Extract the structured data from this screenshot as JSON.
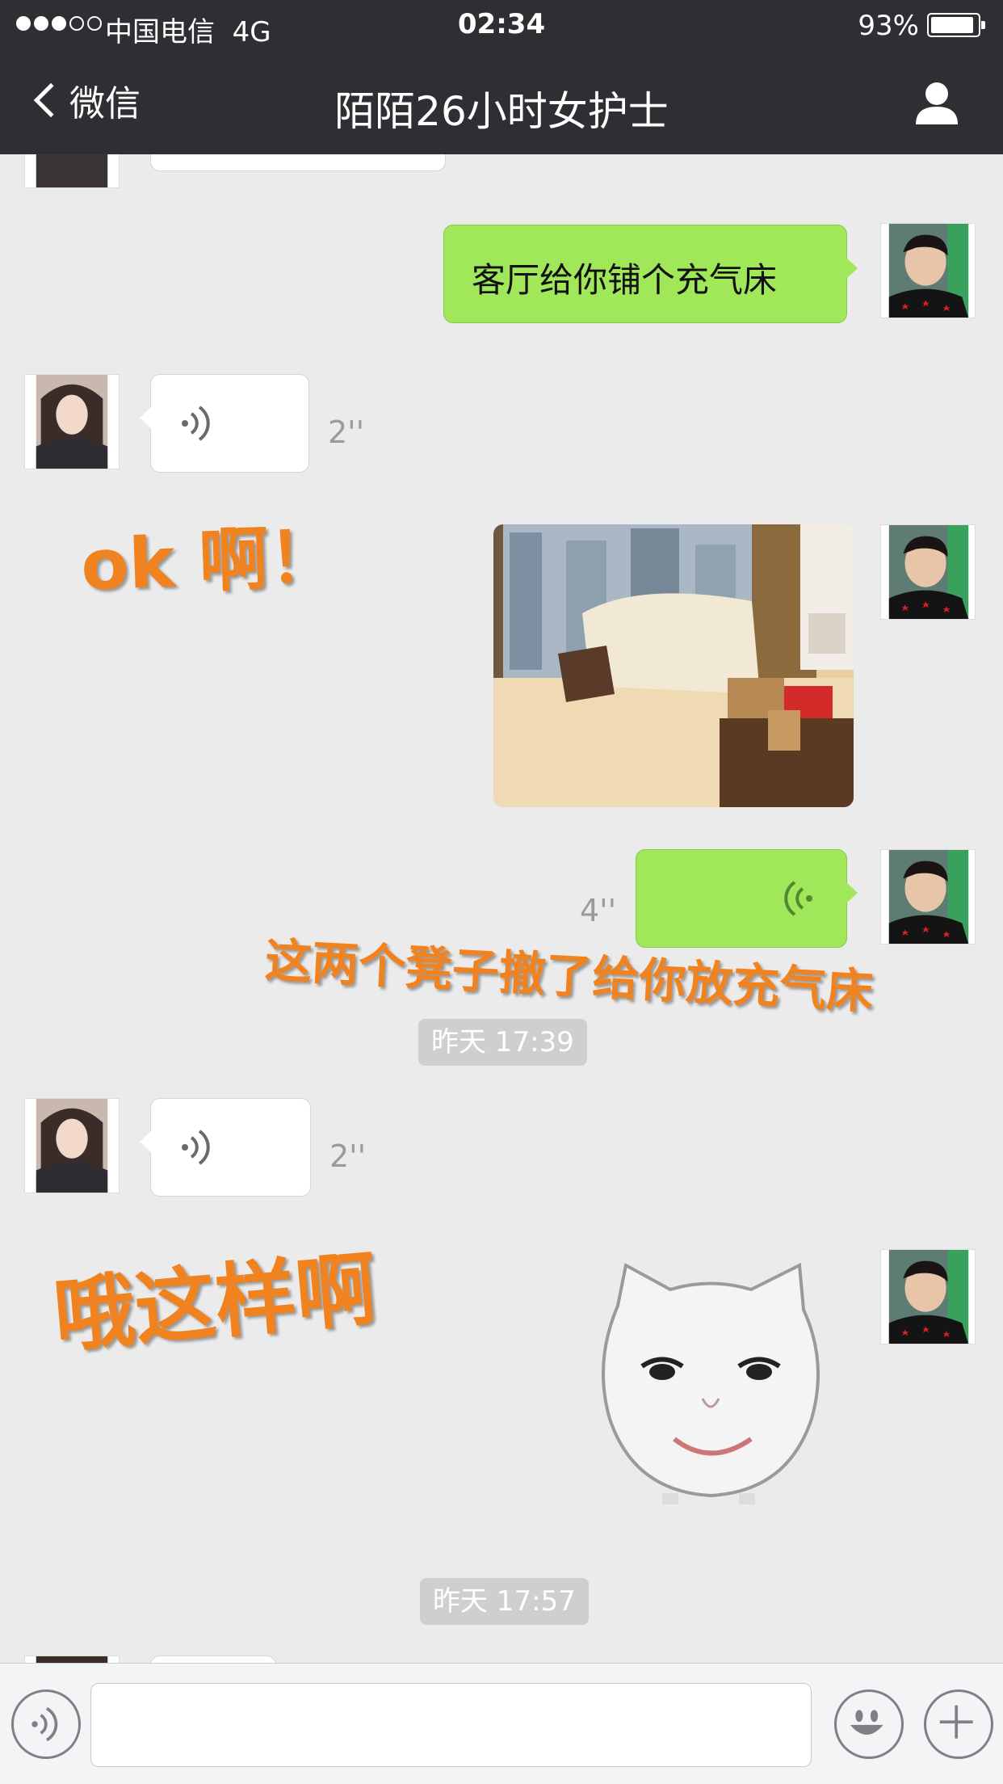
{
  "status_bar": {
    "carrier": "中国电信",
    "network": "4G",
    "time": "02:34",
    "battery_text": "93%",
    "battery_level": 0.93,
    "signal_bars": 3
  },
  "nav": {
    "back_label": "微信",
    "title": "陌陌26小时女护士"
  },
  "messages": {
    "text_1": "客厅给你铺个充气床",
    "voice_1_duration": "2''",
    "voice_2_duration": "4''",
    "voice_3_duration": "2''"
  },
  "overlays": {
    "caption_1": "ok  啊！",
    "caption_2": "这两个凳子撤了给你放充气床",
    "caption_3": "哦这样啊"
  },
  "timestamps": {
    "t1": "昨天 17:39",
    "t2": "昨天 17:57"
  },
  "input": {
    "value": ""
  },
  "colors": {
    "nav_bg": "#2f2e33",
    "chat_bg": "#ebebeb",
    "bubble_green": "#a0e75a",
    "caption_orange": "#f0821f"
  },
  "icons": [
    "back-chevron-icon",
    "profile-icon",
    "voice-icon",
    "emoji-icon",
    "plus-icon"
  ]
}
